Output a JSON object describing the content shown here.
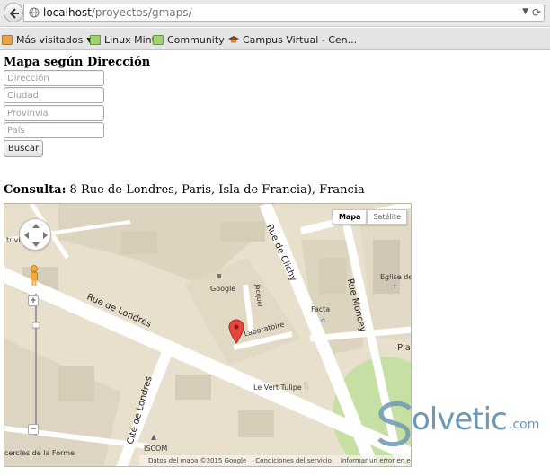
{
  "browser": {
    "url_host": "localhost",
    "url_path": "/proyectos/gmaps/",
    "bookmarks": [
      {
        "label": "Más visitados",
        "icon": "folder-icon"
      },
      {
        "label": "Linux Mint",
        "icon": "page-icon"
      },
      {
        "label": "Community",
        "icon": "page-icon"
      },
      {
        "label": "Campus Virtual - Cen...",
        "icon": "hat-icon"
      }
    ]
  },
  "page": {
    "title": "Mapa según Dirección",
    "form": {
      "direccion_placeholder": "Dirección",
      "ciudad_placeholder": "Ciudad",
      "provincia_placeholder": "Provinvia",
      "pais_placeholder": "País",
      "submit_label": "Buscar"
    },
    "consulta_label": "Consulta:",
    "consulta_value": "8 Rue de Londres, Paris, Isla de Francia), Francia"
  },
  "map": {
    "type_controls": [
      "Mapa",
      "Satélite"
    ],
    "active_type": "Mapa",
    "streets": [
      "Rue de Londres",
      "Rue de Clichy",
      "Rue Moncey",
      "Cité de Londres"
    ],
    "places": [
      "Google",
      "Facta",
      "Eglise de",
      "Laboratoire",
      "Le Vert Tulipe",
      "ISCOM",
      "Plac",
      "cercles de la Forme",
      "trivi",
      "Jacquel"
    ],
    "footer": [
      "Datos del mapa ©2015 Google",
      "Condiciones del servicio",
      "Informar un error en el mapa"
    ],
    "colors": {
      "land": "#e8e0cd",
      "road": "#ffffff",
      "park": "#c6dfa3",
      "marker": "#e6463d"
    }
  },
  "watermark": {
    "text": "olvetic",
    "suffix": ".com"
  }
}
